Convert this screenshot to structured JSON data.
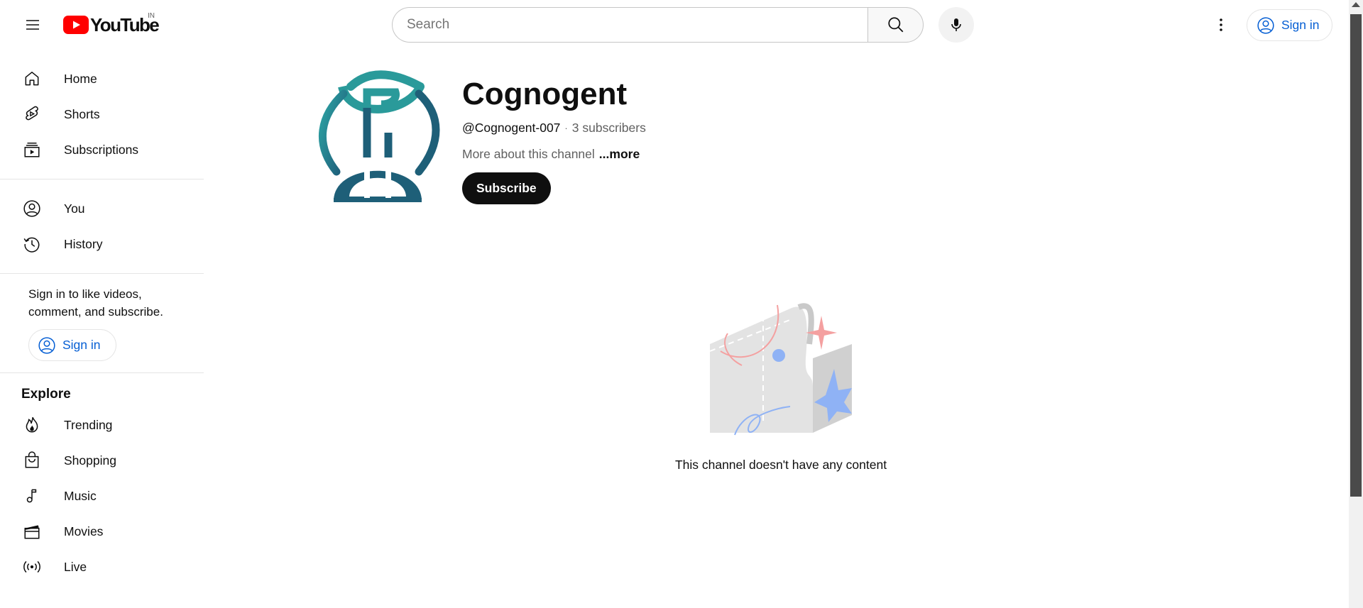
{
  "header": {
    "logo_text": "YouTube",
    "country_code": "IN",
    "search_placeholder": "Search",
    "sign_in_label": "Sign in"
  },
  "sidebar": {
    "primary": [
      {
        "label": "Home",
        "icon": "home-icon"
      },
      {
        "label": "Shorts",
        "icon": "shorts-icon"
      },
      {
        "label": "Subscriptions",
        "icon": "subscriptions-icon"
      }
    ],
    "you": [
      {
        "label": "You",
        "icon": "you-icon"
      },
      {
        "label": "History",
        "icon": "history-icon"
      }
    ],
    "signin_prompt": "Sign in to like videos, comment, and subscribe.",
    "signin_label": "Sign in",
    "explore_title": "Explore",
    "explore": [
      {
        "label": "Trending",
        "icon": "trending-icon"
      },
      {
        "label": "Shopping",
        "icon": "shopping-icon"
      },
      {
        "label": "Music",
        "icon": "music-icon"
      },
      {
        "label": "Movies",
        "icon": "movies-icon"
      },
      {
        "label": "Live",
        "icon": "live-icon"
      }
    ]
  },
  "channel": {
    "name": "Cognogent",
    "handle": "@Cognogent-007",
    "separator": "·",
    "subscribers": "3 subscribers",
    "about": "More about this channel",
    "more": "...more",
    "subscribe_label": "Subscribe"
  },
  "empty_state": {
    "message": "This channel doesn't have any content"
  },
  "colors": {
    "brand_red": "#ff0000",
    "link_blue": "#065fd4",
    "logo_teal": "#2a9a9a",
    "logo_dark_teal": "#1e5f78"
  }
}
